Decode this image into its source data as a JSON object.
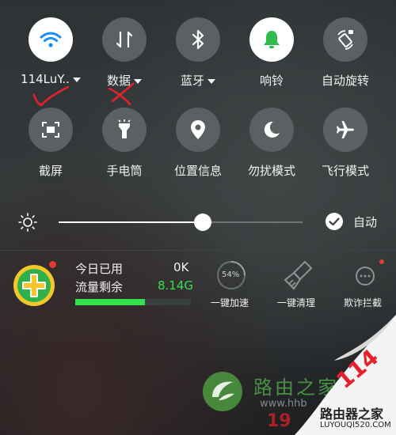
{
  "quick_settings": {
    "row1": [
      {
        "name": "wifi",
        "label": "114LuY..",
        "has_caret": true,
        "on": true,
        "icon": "wifi-icon"
      },
      {
        "name": "data",
        "label": "数据",
        "has_caret": true,
        "on": false,
        "icon": "mobile-data-icon"
      },
      {
        "name": "bluetooth",
        "label": "蓝牙",
        "has_caret": true,
        "on": false,
        "icon": "bluetooth-icon"
      },
      {
        "name": "ring",
        "label": "响铃",
        "has_caret": false,
        "on": true,
        "icon": "bell-icon"
      },
      {
        "name": "rotate",
        "label": "自动旋转",
        "has_caret": false,
        "on": false,
        "icon": "auto-rotate-icon"
      }
    ],
    "row2": [
      {
        "name": "screenshot",
        "label": "截屏",
        "icon": "screenshot-icon"
      },
      {
        "name": "flashlight",
        "label": "手电筒",
        "icon": "flashlight-icon"
      },
      {
        "name": "location",
        "label": "位置信息",
        "icon": "location-icon"
      },
      {
        "name": "dnd",
        "label": "勿扰模式",
        "icon": "moon-icon"
      },
      {
        "name": "airplane",
        "label": "飞行模式",
        "icon": "airplane-icon"
      }
    ]
  },
  "brightness": {
    "level": 0.59,
    "auto_label": "自动",
    "auto_checked": true
  },
  "traffic_widget": {
    "used_today_label": "今日已用",
    "used_today_value": "0K",
    "remaining_label": "流量剩余",
    "remaining_value": "8.14G",
    "remaining_fraction": 0.6,
    "accelerate_percent": "54%",
    "actions": [
      "一键加速",
      "一键清理",
      "欺诈拦截"
    ]
  },
  "watermark": {
    "text_cn": "路由之家",
    "text_url": "www.hhb",
    "number": "19",
    "corner_badge_num": "114",
    "corner_badge_text": "路由器之家",
    "corner_url": "LUYOUQI520.COM"
  },
  "colors": {
    "accent_green": "#35e04f",
    "active_icon_blue": "#1a8cff",
    "active_icon_green": "#2ebd4c",
    "annotation_red": "#e8202a",
    "notification_dot": "#e53935"
  }
}
